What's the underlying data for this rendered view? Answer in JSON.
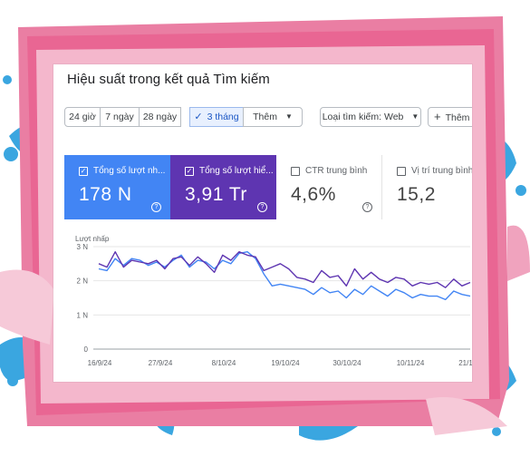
{
  "title": "Hiệu suất trong kết quả Tìm kiếm",
  "filters": {
    "date_ranges": [
      "24 giờ",
      "7 ngày",
      "28 ngày",
      "3 tháng"
    ],
    "selected": "3 tháng",
    "more": "Thêm",
    "search_type": "Loại tìm kiếm: Web",
    "add_filter": "Thêm b"
  },
  "metrics": [
    {
      "label": "Tổng số lượt nh...",
      "value": "178 N",
      "checked": true
    },
    {
      "label": "Tổng số lượt hiể...",
      "value": "3,91 Tr",
      "checked": true
    },
    {
      "label": "CTR trung bình",
      "value": "4,6%",
      "checked": false
    },
    {
      "label": "Vị trí trung bình",
      "value": "15,2",
      "checked": false
    }
  ],
  "colors": {
    "clicks": "#4285f4",
    "impressions": "#5e35b1",
    "accent": "#1a56c4"
  },
  "chart_data": {
    "type": "line",
    "ylabel": "Lượt nhấp",
    "y_ticks": [
      "0",
      "1 N",
      "2 N",
      "3 N"
    ],
    "ylim": [
      0,
      3000
    ],
    "x_ticks": [
      "16/9/24",
      "27/9/24",
      "8/10/24",
      "19/10/24",
      "30/10/24",
      "10/11/24",
      "21/1"
    ],
    "grid": true,
    "series": [
      {
        "values": [
          2350,
          2300,
          2650,
          2450,
          2650,
          2600,
          2450,
          2550,
          2400,
          2600,
          2750,
          2400,
          2600,
          2550,
          2350,
          2600,
          2500,
          2800,
          2850,
          2650,
          2200,
          1850,
          1900,
          1850,
          1800,
          1750,
          1600,
          1800,
          1650,
          1700,
          1500,
          1750,
          1600,
          1850,
          1700,
          1550,
          1750,
          1650,
          1500,
          1600,
          1550,
          1550,
          1450,
          1700,
          1600,
          1550
        ]
      },
      {
        "values": [
          2500,
          2400,
          2850,
          2400,
          2600,
          2550,
          2500,
          2600,
          2350,
          2650,
          2700,
          2450,
          2700,
          2500,
          2250,
          2750,
          2600,
          2850,
          2750,
          2700,
          2300,
          2400,
          2500,
          2350,
          2100,
          2050,
          1950,
          2300,
          2100,
          2150,
          1850,
          2350,
          2050,
          2250,
          2050,
          1950,
          2100,
          2050,
          1850,
          1950,
          1900,
          1950,
          1800,
          2050,
          1850,
          1950
        ]
      }
    ]
  }
}
